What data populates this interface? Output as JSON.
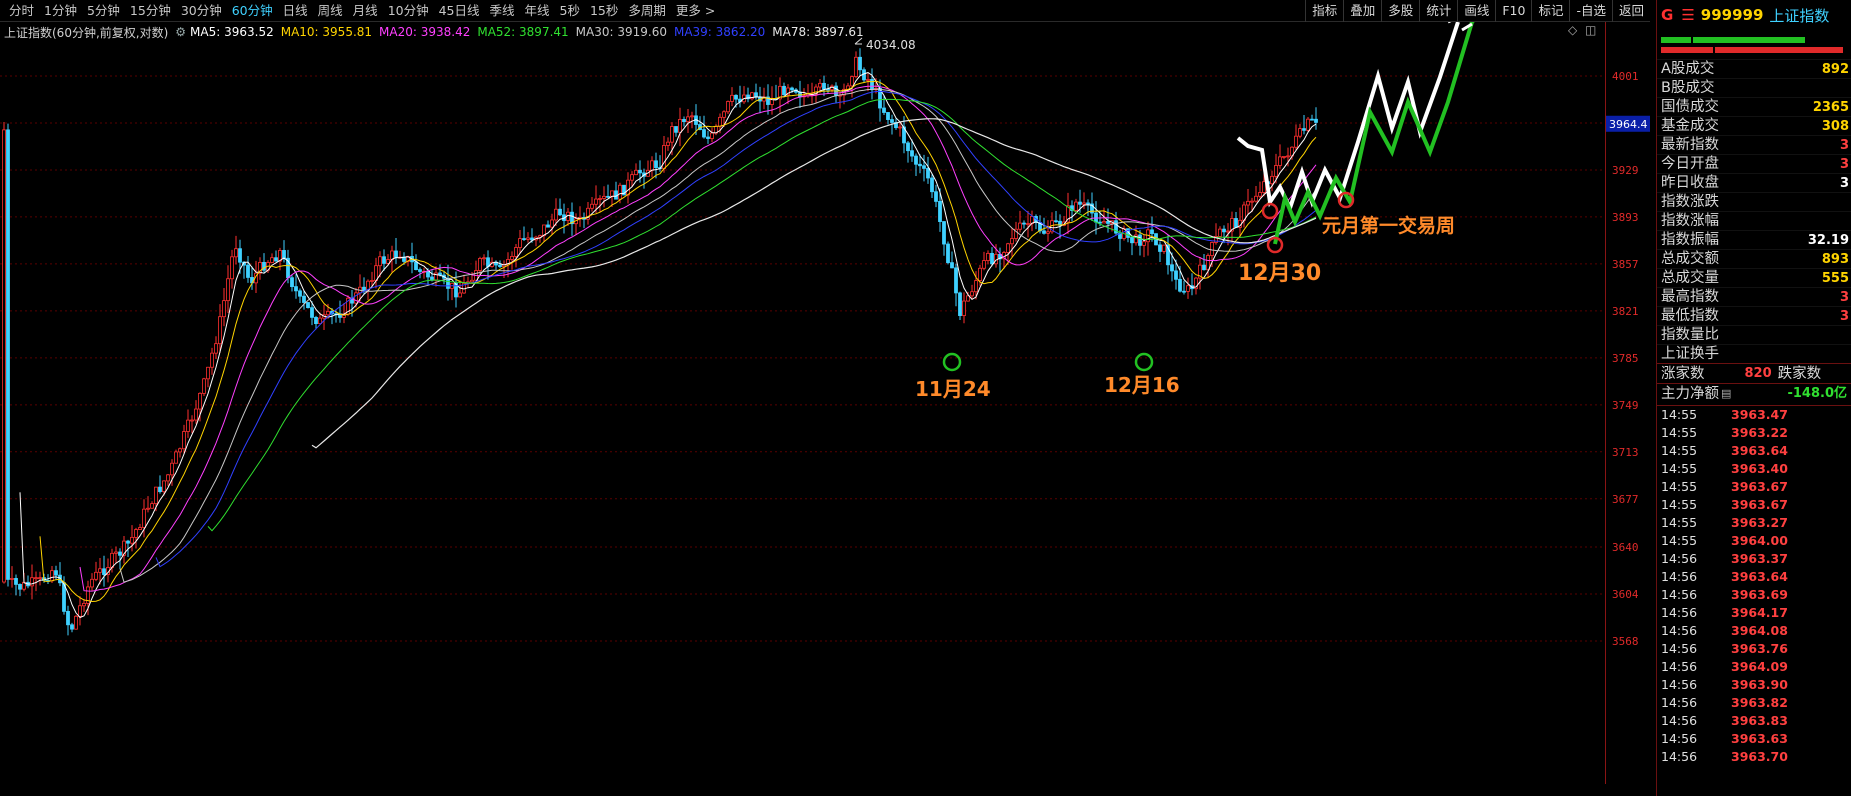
{
  "periods": [
    "分时",
    "1分钟",
    "5分钟",
    "15分钟",
    "30分钟",
    "60分钟",
    "日线",
    "周线",
    "月线",
    "10分钟",
    "45日线",
    "季线",
    "年线",
    "5秒",
    "15秒",
    "多周期",
    "更多 >"
  ],
  "active_period": 5,
  "tools": [
    "指标",
    "叠加",
    "多股",
    "统计",
    "画线",
    "F10",
    "标记",
    "-自选",
    "返回"
  ],
  "legend": {
    "title": "上证指数(60分钟,前复权,对数)",
    "items": [
      {
        "text": "MA5: 3963.52",
        "color": "#ffffff"
      },
      {
        "text": "MA10: 3955.81",
        "color": "#ffd400"
      },
      {
        "text": "MA20: 3938.42",
        "color": "#ff40ff"
      },
      {
        "text": "MA52: 3897.41",
        "color": "#30e030"
      },
      {
        "text": "MA30: 3919.60",
        "color": "#c8c8c8"
      },
      {
        "text": "MA39: 3862.20",
        "color": "#3040ff"
      },
      {
        "text": "MA78: 3897.61",
        "color": "#e8e8e8"
      }
    ]
  },
  "chart": {
    "y_ticks": [
      4001,
      3965,
      3929,
      3893,
      3857,
      3821,
      3785,
      3749,
      3713,
      3677,
      3640,
      3604,
      3568
    ],
    "last_price_tag": "3964.4",
    "high_label": "4034.08",
    "annotations": [
      {
        "text": "11月24",
        "color": "#ff8a2a"
      },
      {
        "text": "12月16",
        "color": "#ff8a2a"
      },
      {
        "text": "12月30",
        "color": "#ff8a2a"
      },
      {
        "text": "元月第一交易周",
        "color": "#ff8a2a"
      }
    ]
  },
  "panel": {
    "prefix": "G",
    "code": "999999",
    "name": "上证指数",
    "stats": [
      {
        "label": "A股成交",
        "value": "892",
        "color": "#ffd400"
      },
      {
        "label": "B股成交",
        "value": "",
        "color": "#ffd400"
      },
      {
        "label": "国债成交",
        "value": "2365",
        "color": "#ffd400"
      },
      {
        "label": "基金成交",
        "value": "308",
        "color": "#ffd400"
      },
      {
        "label": "最新指数",
        "value": "3",
        "color": "#ff4040"
      },
      {
        "label": "今日开盘",
        "value": "3",
        "color": "#ff4040"
      },
      {
        "label": "昨日收盘",
        "value": "3",
        "color": "#ffffff"
      },
      {
        "label": "指数涨跌",
        "value": "",
        "color": "#ff4040"
      },
      {
        "label": "指数涨幅",
        "value": "",
        "color": "#ff4040"
      },
      {
        "label": "指数振幅",
        "value": "32.19",
        "color": "#ffffff"
      },
      {
        "label": "总成交额",
        "value": "893",
        "color": "#ffd400"
      },
      {
        "label": "总成交量",
        "value": "555",
        "color": "#ffd400"
      },
      {
        "label": "最高指数",
        "value": "3",
        "color": "#ff4040"
      },
      {
        "label": "最低指数",
        "value": "3",
        "color": "#ff4040"
      },
      {
        "label": "指数量比",
        "value": "",
        "color": "#ffffff"
      },
      {
        "label": "上证换手",
        "value": "",
        "color": "#ffffff"
      }
    ],
    "up_label": "涨家数",
    "up_value": "820",
    "down_label": "跌家数",
    "netflow_label": "主力净额",
    "netflow_value": "-148.0亿",
    "ticks": [
      {
        "t": "14:55",
        "p": "3963.47"
      },
      {
        "t": "14:55",
        "p": "3963.22"
      },
      {
        "t": "14:55",
        "p": "3963.64"
      },
      {
        "t": "14:55",
        "p": "3963.40"
      },
      {
        "t": "14:55",
        "p": "3963.67"
      },
      {
        "t": "14:55",
        "p": "3963.67"
      },
      {
        "t": "14:55",
        "p": "3963.27"
      },
      {
        "t": "14:55",
        "p": "3964.00"
      },
      {
        "t": "14:56",
        "p": "3963.37"
      },
      {
        "t": "14:56",
        "p": "3963.64"
      },
      {
        "t": "14:56",
        "p": "3963.69"
      },
      {
        "t": "14:56",
        "p": "3964.17"
      },
      {
        "t": "14:56",
        "p": "3964.08"
      },
      {
        "t": "14:56",
        "p": "3963.76"
      },
      {
        "t": "14:56",
        "p": "3964.09"
      },
      {
        "t": "14:56",
        "p": "3963.90"
      },
      {
        "t": "14:56",
        "p": "3963.82"
      },
      {
        "t": "14:56",
        "p": "3963.83"
      },
      {
        "t": "14:56",
        "p": "3963.63"
      },
      {
        "t": "14:56",
        "p": "3963.70"
      }
    ]
  },
  "colors": {
    "up": "#ff3030",
    "down": "#3fd1ff",
    "grid": "#5a0000",
    "accent": "#ff8a2a"
  }
}
